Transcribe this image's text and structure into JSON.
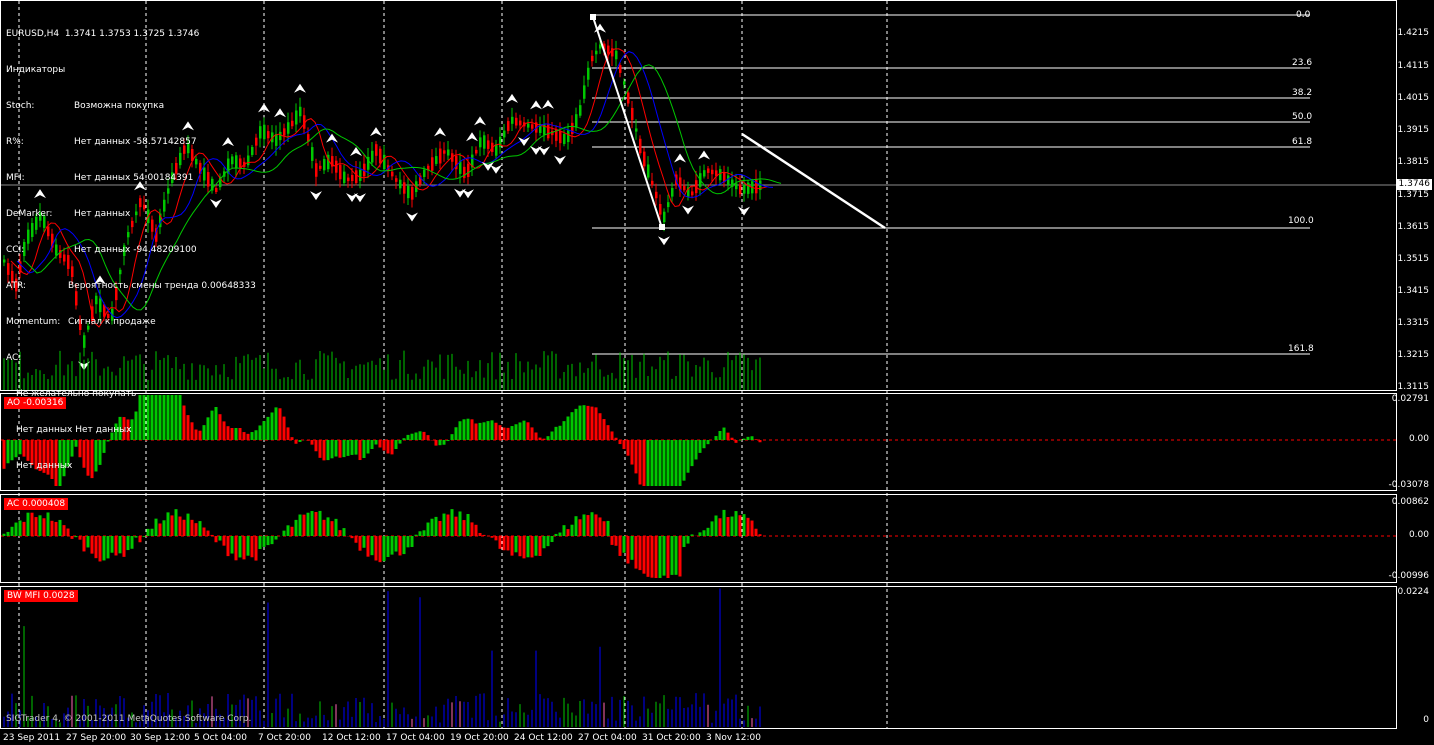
{
  "header": {
    "symbol_line": "EURUSD,H4  1.3741 1.3753 1.3725 1.3746",
    "indicators_title": "Индикаторы"
  },
  "indicators": [
    {
      "name": "Stoch:",
      "value": "Возможна покупка"
    },
    {
      "name": "R%:",
      "value": "Нет данных -58.57142857"
    },
    {
      "name": "MFI:",
      "value": "Нет данных 54.00184391"
    },
    {
      "name": "DeMarker:",
      "value": "Нет данных"
    },
    {
      "name": "CCI:",
      "value": "Нет данных -94.48209100"
    },
    {
      "name": "ATR:",
      "value": "Вероятность смены тренда 0.00648333"
    },
    {
      "name": "Momentum:",
      "value": "Сигнал к продаже"
    },
    {
      "name": "AC:",
      "value": ""
    }
  ],
  "ac_notes": [
    "Не желательно покупать",
    "Нет данных Нет данных",
    "Нет данных"
  ],
  "current_price": "1.3746",
  "price_axis": [
    "1.4215",
    "1.4115",
    "1.4015",
    "1.3915",
    "1.3815",
    "1.3715",
    "1.3615",
    "1.3515",
    "1.3415",
    "1.3315",
    "1.3215",
    "1.3115"
  ],
  "fib_levels": [
    "0.0",
    "23.6",
    "38.2",
    "50.0",
    "61.8",
    "100.0",
    "161.8"
  ],
  "panes": {
    "ao": {
      "label": "AO -0.00316",
      "top": "0.02791",
      "zero": "0.00",
      "bottom": "-0.03078"
    },
    "ac": {
      "label": "AC 0.000408",
      "top": "0.00862",
      "zero": "0.00",
      "bottom": "-0.00996"
    },
    "mfi": {
      "label": "BW MFI 0.0028",
      "top": "0.0224",
      "bottom": "0"
    }
  },
  "dates": [
    "23 Sep 2011",
    "27 Sep 20:00",
    "30 Sep 12:00",
    "5 Oct 04:00",
    "7 Oct 20:00",
    "12 Oct 12:00",
    "17 Oct 04:00",
    "19 Oct 20:00",
    "24 Oct 12:00",
    "27 Oct 04:00",
    "31 Oct 20:00",
    "3 Nov 12:00"
  ],
  "copyright": "SIGTrader 4, © 2001-2011 MetaQuotes Software Corp.",
  "colors": {
    "bull": "#00c800",
    "bear": "#ff0000",
    "ma_red": "#ff0000",
    "ma_blue": "#0000ff",
    "ma_green": "#00c800",
    "mfi_blue": "#0000ff"
  }
}
